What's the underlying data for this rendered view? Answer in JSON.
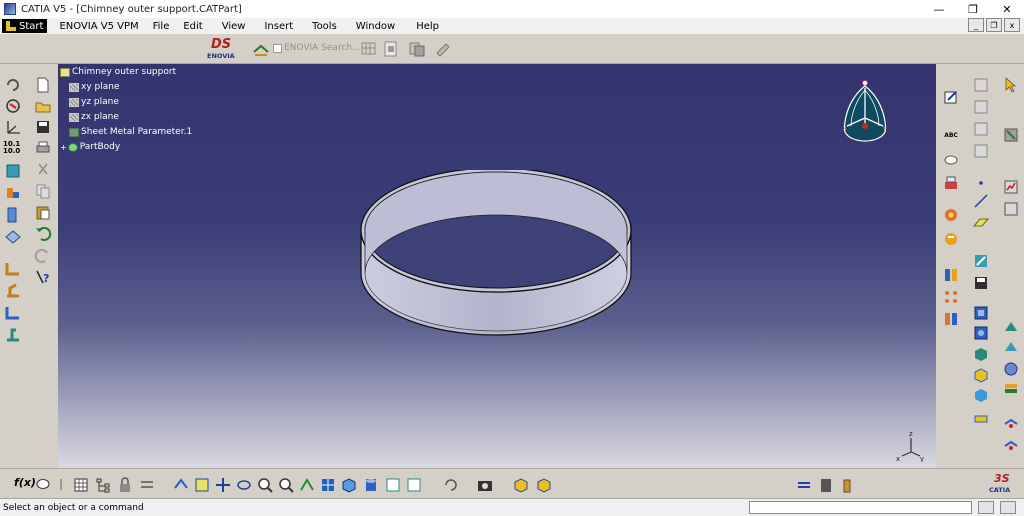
{
  "window": {
    "title": "CATIA V5 - [Chimney outer support.CATPart]",
    "controls": {
      "minimize": "—",
      "maximize": "❐",
      "close": "✕"
    }
  },
  "menu": {
    "start": "Start",
    "items": [
      "ENOVIA V5 VPM",
      "File",
      "Edit",
      "View",
      "Insert",
      "Tools",
      "Window",
      "Help"
    ]
  },
  "toolbar_top": {
    "logo_text": "ENOVIA",
    "logo_mark": "DS",
    "enovia_search_label": "ENOVIA Search..."
  },
  "tree": {
    "root": "Chimney outer support",
    "items": [
      "xy plane",
      "yz plane",
      "zx plane",
      "Sheet Metal Parameter.1",
      "PartBody"
    ]
  },
  "axis": {
    "x": "x",
    "y": "y",
    "z": "z"
  },
  "left_toolbar": {
    "icons": [
      "loop-icon",
      "sketch-icon",
      "axis-icon",
      "measure-icon",
      "part-icon",
      "sheet-icon",
      "flange-icon",
      "surface-icon",
      "bend-icon",
      "unfold-icon",
      "wall-icon",
      "stamp-icon",
      "new-icon",
      "open-icon",
      "save-icon",
      "print-icon",
      "cut-icon",
      "copy-icon",
      "paste-icon",
      "undo-icon",
      "redo-icon",
      "help-icon"
    ],
    "measure_label": "10.1 10.0"
  },
  "right_toolbar": {
    "text_label": "ABC"
  },
  "status": {
    "message": "Select an object or a command"
  },
  "colors": {
    "viewport_top": "#34346e",
    "viewport_bottom": "#d9d8e2",
    "ring_fill": "#bfc0d6",
    "compass_fill": "#0f4a5e"
  }
}
